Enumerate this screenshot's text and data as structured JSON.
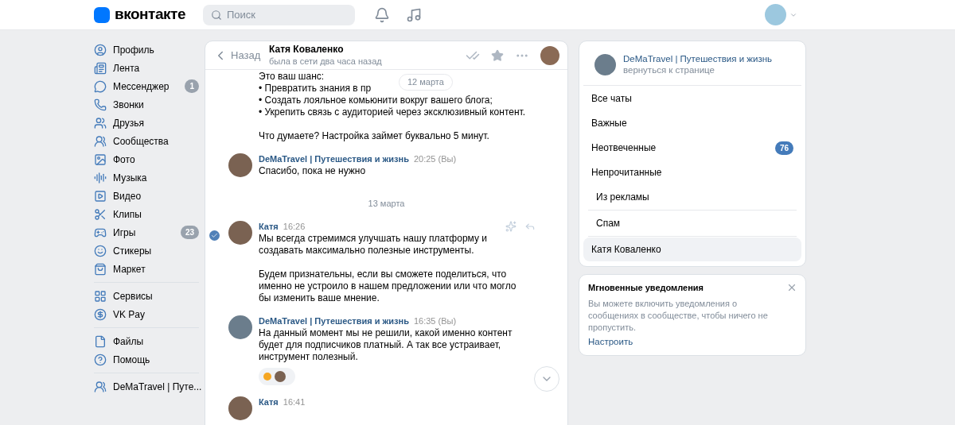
{
  "header": {
    "logo": "вконтакте",
    "search": {
      "placeholder": "Поиск"
    }
  },
  "sidebar": {
    "groups": [
      [
        {
          "label": "Профиль"
        },
        {
          "label": "Лента"
        },
        {
          "label": "Мессенджер",
          "badge": "1"
        },
        {
          "label": "Звонки"
        },
        {
          "label": "Друзья"
        },
        {
          "label": "Сообщества"
        },
        {
          "label": "Фото"
        },
        {
          "label": "Музыка"
        },
        {
          "label": "Видео"
        },
        {
          "label": "Клипы"
        },
        {
          "label": "Игры",
          "badge": "23"
        },
        {
          "label": "Стикеры"
        },
        {
          "label": "Маркет"
        }
      ],
      [
        {
          "label": "Сервисы"
        },
        {
          "label": "VK Pay"
        }
      ],
      [
        {
          "label": "Файлы"
        },
        {
          "label": "Помощь"
        }
      ],
      [
        {
          "label": "DeMaTravel | Путе..."
        }
      ]
    ]
  },
  "chat": {
    "back": "Назад",
    "name": "Катя Коваленко",
    "status": "была в сети два часа назад",
    "top_paragraphs": [
      [
        "Это ваш шанс:",
        "• Превратить знания в пр",
        "• Создать лояльное комьюнити вокруг вашего блога;",
        "• Укрепить связь с аудиторией через эксклюзивный контент."
      ],
      [
        "Что думаете? Настройка займет буквально 5 минут."
      ]
    ],
    "date_pill": "12 марта",
    "items": [
      {
        "kind": "message",
        "author": "DeMaTravel | Путешествия и жизнь",
        "time": "20:25 (Вы)",
        "paragraphs": [
          "Спасибо, пока не нужно"
        ],
        "selected": false
      },
      {
        "kind": "date",
        "text": "13 марта"
      },
      {
        "kind": "message",
        "author": "Катя",
        "time": "16:26",
        "paragraphs": [
          "Мы всегда стремимся улучшать нашу платформу и создавать максимально полезные инструменты.",
          "Будем признательны, если вы сможете поделиться, что именно не устроило в нашем предложении или что могло бы изменить ваше мнение."
        ],
        "selected": true
      },
      {
        "kind": "message",
        "author": "DeMaTravel | Путешествия и жизнь",
        "time": "16:35 (Вы)",
        "paragraphs": [
          "На данный момент мы не решили, какой именно контент будет для подписчиков платный. А так все устраивает, инструмент полезный."
        ],
        "selected": false,
        "reaction": true
      },
      {
        "kind": "message",
        "author": "Катя",
        "time": "16:41",
        "selected": false
      }
    ]
  },
  "right": {
    "community": {
      "name": "DeMaTravel | Путешествия и жизнь",
      "link": "вернуться к странице"
    },
    "folders": [
      {
        "label": "Все чаты",
        "selected": false
      },
      {
        "label": "Важные",
        "selected": false
      },
      {
        "label": "Неотвеченные",
        "selected": false,
        "badge": "76"
      },
      {
        "label": "Непрочитанные",
        "selected": false
      },
      {
        "label": "Из рекламы",
        "selected": false,
        "divider_after": true
      },
      {
        "label": "Спам",
        "selected": false,
        "divider_after": true
      },
      {
        "label": "Катя Коваленко",
        "selected": true
      }
    ],
    "notice": {
      "title": "Мгновенные уведомления",
      "text": "Вы можете включить уведомления о сообщениях в сообществе, чтобы ничего не пропустить.",
      "action": "Настроить"
    }
  }
}
